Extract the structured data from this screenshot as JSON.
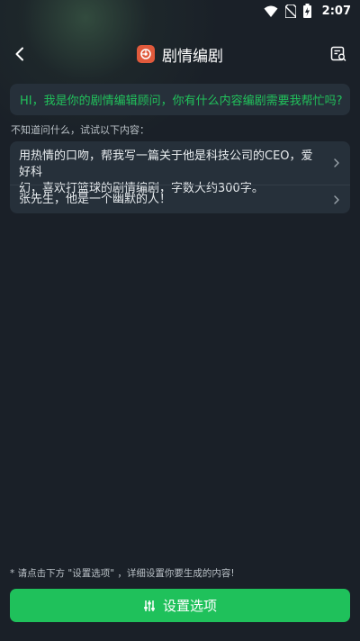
{
  "status": {
    "time": "2:07",
    "icons": [
      "wifi-icon",
      "no-sim-icon",
      "battery-charging-icon"
    ]
  },
  "header": {
    "title": "剧情编剧",
    "back_icon": "chevron-left-icon",
    "title_icon": "drama-badge-icon",
    "history_icon": "history-search-icon"
  },
  "greeting": {
    "text": "HI，我是你的剧情编辑顾问，你有什么内容编剧需要我帮忙吗?"
  },
  "hint": {
    "text": "不知道问什么，试试以下内容："
  },
  "suggestions": [
    {
      "text_line1": "用热情的口吻，帮我写一篇关于他是科技公司的CEO，爱好科",
      "text_line2": "幻，喜欢打篮球的剧情编剧，字数大约300字。"
    },
    {
      "text": "张先生，他是一个幽默的人！"
    }
  ],
  "footer": {
    "note": "* 请点击下方 \"设置选项\" ，详细设置你要生成的内容!",
    "button_label": "设置选项",
    "button_icon": "sliders-icon"
  },
  "colors": {
    "background": "#1a2028",
    "card": "#26303a",
    "accent": "#1fc15b",
    "title_badge": "#e15a3c"
  }
}
